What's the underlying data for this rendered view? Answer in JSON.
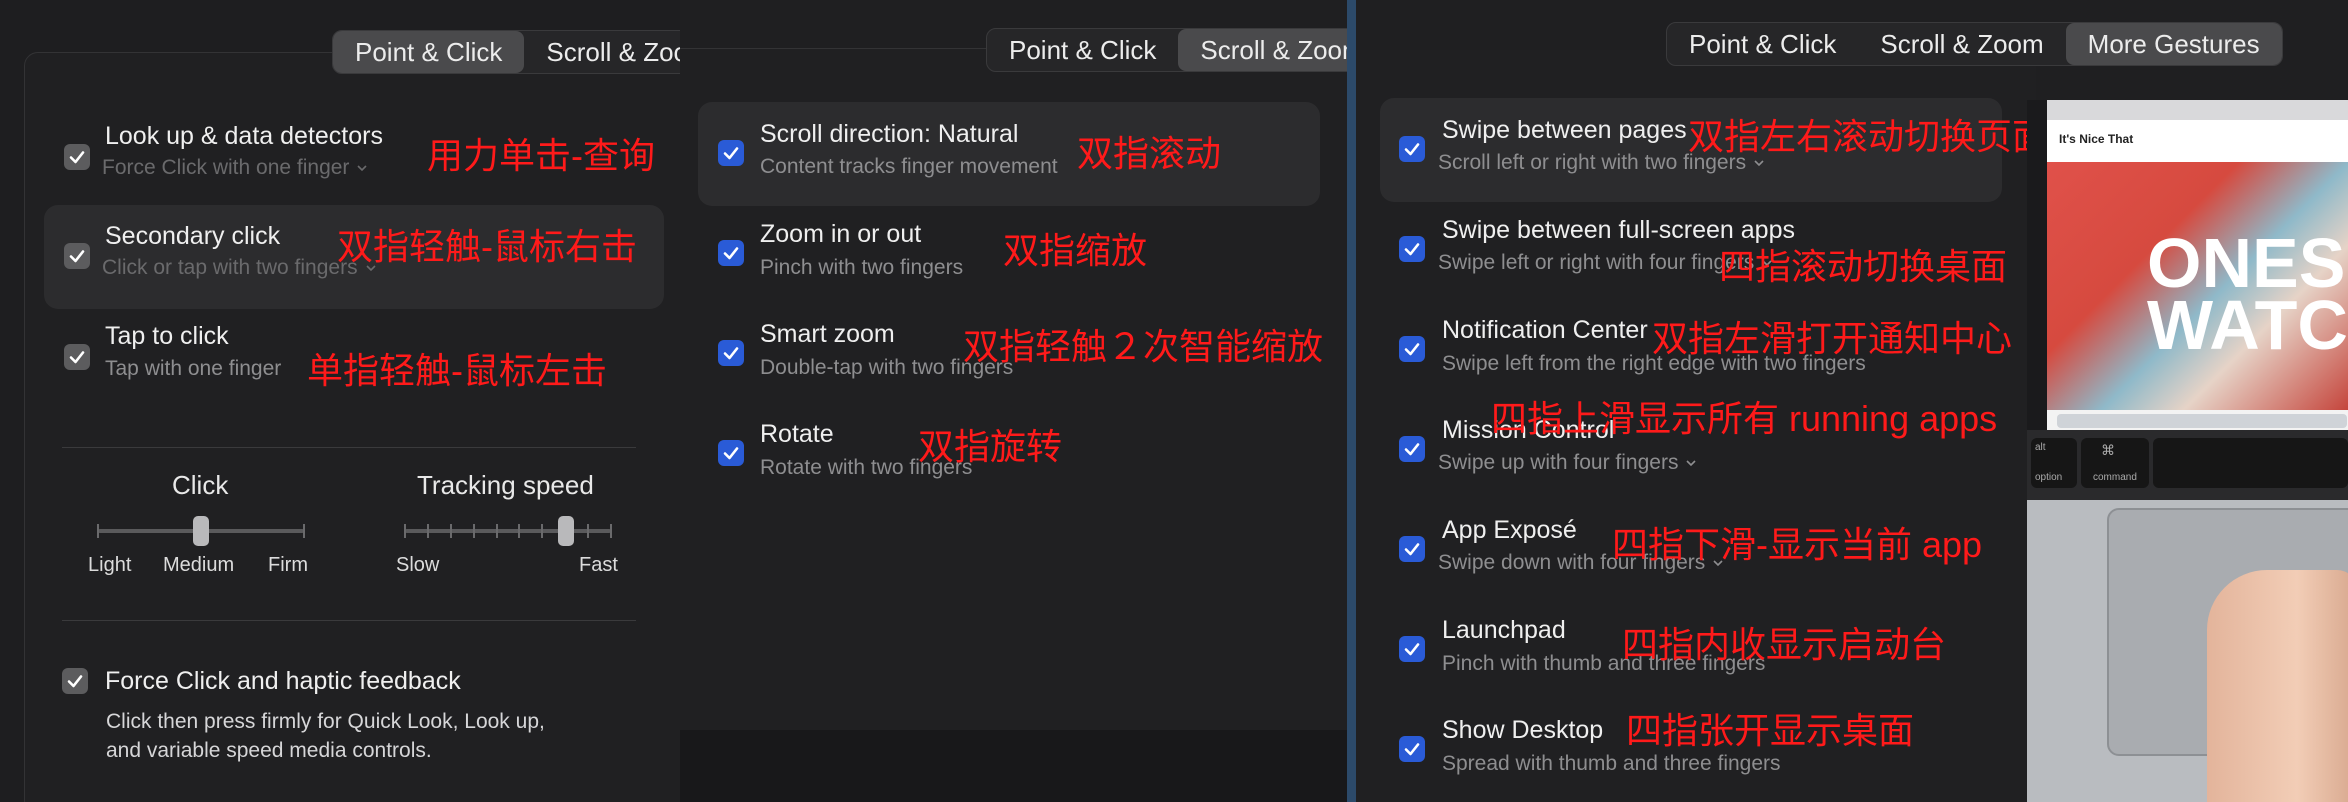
{
  "panel1": {
    "tabs": [
      {
        "label": "Point & Click",
        "active": true
      },
      {
        "label": "Scroll & Zoom",
        "active": false
      }
    ],
    "rows": [
      {
        "title": "Look up & data detectors",
        "sub": "Force Click with one finger",
        "annotation": "用力单击-查询"
      },
      {
        "title": "Secondary click",
        "sub": "Click or tap with two fingers",
        "annotation": "双指轻触-鼠标右击"
      },
      {
        "title": "Tap to click",
        "sub": "Tap with one finger",
        "annotation": "单指轻触-鼠标左击"
      }
    ],
    "click_slider": {
      "title": "Click",
      "labels": [
        "Light",
        "Medium",
        "Firm"
      ],
      "value": "Medium"
    },
    "tracking_slider": {
      "title": "Tracking speed",
      "labels": [
        "Slow",
        "Fast"
      ],
      "value_fraction": 0.78
    },
    "force_click": {
      "title": "Force Click and haptic feedback",
      "desc_line1": "Click then press firmly for Quick Look, Look up,",
      "desc_line2": "and variable speed media controls."
    }
  },
  "panel2": {
    "tabs": [
      {
        "label": "Point & Click",
        "active": false
      },
      {
        "label": "Scroll & Zoom",
        "active": true
      }
    ],
    "rows": [
      {
        "title": "Scroll direction: Natural",
        "sub": "Content tracks finger movement",
        "annotation": "双指滚动"
      },
      {
        "title": "Zoom in or out",
        "sub": "Pinch with two fingers",
        "annotation": "双指缩放"
      },
      {
        "title": "Smart zoom",
        "sub": "Double-tap with two fingers",
        "annotation": "双指轻触２次智能缩放"
      },
      {
        "title": "Rotate",
        "sub": "Rotate with two fingers",
        "annotation": "双指旋转"
      }
    ]
  },
  "panel3": {
    "tabs": [
      {
        "label": "Point & Click",
        "active": false
      },
      {
        "label": "Scroll & Zoom",
        "active": false
      },
      {
        "label": "More Gestures",
        "active": true
      }
    ],
    "rows": [
      {
        "title": "Swipe between pages",
        "sub": "Scroll left or right with two fingers",
        "annotation": "双指左右滚动切换页面"
      },
      {
        "title": "Swipe between full-screen apps",
        "sub": "Swipe left or right with four fingers",
        "annotation": "四指滚动切换桌面"
      },
      {
        "title": "Notification Center",
        "sub": "Swipe left from the right edge with two fingers",
        "annotation": "双指左滑打开通知中心"
      },
      {
        "title": "Mission Control",
        "sub": "Swipe up with four fingers",
        "annotation": "四指上滑显示所有 running apps"
      },
      {
        "title": "App Exposé",
        "sub": "Swipe down with four fingers",
        "annotation": "四指下滑-显示当前 app"
      },
      {
        "title": "Launchpad",
        "sub": "Pinch with thumb and three fingers",
        "annotation": "四指内收显示启动台"
      },
      {
        "title": "Show Desktop",
        "sub": "Spread with thumb and three fingers",
        "annotation": "四指张开显示桌面"
      }
    ]
  },
  "photo": {
    "site": "It's Nice That",
    "headline_1": "ONES",
    "headline_2": "WATC",
    "key_option": "option",
    "key_command": "command",
    "key_alt": "alt"
  }
}
